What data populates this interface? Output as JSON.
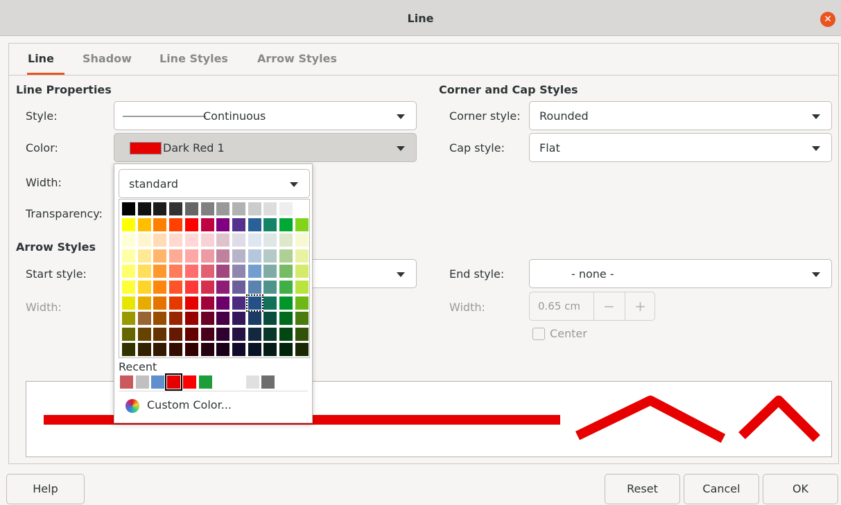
{
  "window": {
    "title": "Line"
  },
  "tabs": [
    {
      "label": "Line",
      "active": true
    },
    {
      "label": "Shadow"
    },
    {
      "label": "Line Styles"
    },
    {
      "label": "Arrow Styles"
    }
  ],
  "line_properties": {
    "title": "Line Properties",
    "style_label": "Style:",
    "style_value": "Continuous",
    "color_label": "Color:",
    "color_value": "Dark Red 1",
    "color_hex": "#e60000",
    "width_label": "Width:",
    "transparency_label": "Transparency:"
  },
  "corner_cap": {
    "title": "Corner and Cap Styles",
    "corner_label": "Corner style:",
    "corner_value": "Rounded",
    "cap_label": "Cap style:",
    "cap_value": "Flat"
  },
  "arrow_styles": {
    "title": "Arrow Styles",
    "start_label": "Start style:",
    "start_width_label": "Width:",
    "end_label": "End style:",
    "end_value": "- none -",
    "end_width_label": "Width:",
    "end_width_value": "0.65 cm",
    "center_label": "Center"
  },
  "color_popup": {
    "palette": "standard",
    "recent_label": "Recent",
    "custom_color_label": "Custom Color...",
    "grid": [
      [
        "#000000",
        "#111111",
        "#1c1c1c",
        "#333333",
        "#666666",
        "#808080",
        "#999999",
        "#b2b2b2",
        "#cccccc",
        "#dddddd",
        "#eeeeee",
        "#ffffff"
      ],
      [
        "#ffff00",
        "#ffbf00",
        "#ff8000",
        "#ff4000",
        "#ff0000",
        "#bf0041",
        "#800080",
        "#55308d",
        "#2a6099",
        "#158466",
        "#00a933",
        "#81d41a"
      ],
      [
        "#ffffd7",
        "#fff5ce",
        "#ffdbb6",
        "#ffd8ce",
        "#ffd7d7",
        "#f7d1d5",
        "#e0c2cd",
        "#dedce6",
        "#dee6ef",
        "#dee7e5",
        "#dde8cb",
        "#f6f9d4"
      ],
      [
        "#ffffa6",
        "#ffe994",
        "#ffb66c",
        "#ffaa95",
        "#ffa6a6",
        "#ec9ba4",
        "#bf819e",
        "#b7b3ca",
        "#b4c7dc",
        "#b3cac7",
        "#afd095",
        "#e8f2a1"
      ],
      [
        "#ffff6d",
        "#ffde59",
        "#ff972f",
        "#ff7b59",
        "#ff6d6d",
        "#e16173",
        "#a1467e",
        "#8e86ae",
        "#729fcf",
        "#81aca6",
        "#77bc65",
        "#d4ea6b"
      ],
      [
        "#ffff38",
        "#ffd428",
        "#ff860d",
        "#ff5429",
        "#ff3838",
        "#d62e4e",
        "#8d1d75",
        "#6b5e9b",
        "#5983b0",
        "#50938a",
        "#3faf46",
        "#bbe33d"
      ],
      [
        "#e6e600",
        "#e6ac00",
        "#e67300",
        "#e63900",
        "#e60000",
        "#a1003a",
        "#6b006b",
        "#4c2a7f",
        "#235187",
        "#127159",
        "#009628",
        "#6fb716"
      ],
      [
        "#999900",
        "#996633",
        "#994d00",
        "#992600",
        "#990000",
        "#6b0026",
        "#470047",
        "#33195c",
        "#1a3c65",
        "#0b4d3d",
        "#006b1c",
        "#4a7b0e"
      ],
      [
        "#666600",
        "#664400",
        "#663300",
        "#661900",
        "#660000",
        "#48001a",
        "#300030",
        "#261142",
        "#112840",
        "#083729",
        "#004711",
        "#325209"
      ],
      [
        "#333300",
        "#332200",
        "#331900",
        "#330d00",
        "#330000",
        "#240010",
        "#180018",
        "#13092c",
        "#081425",
        "#041c15",
        "#002409",
        "#192904"
      ]
    ],
    "selected": [
      6,
      8
    ],
    "recent": [
      "#c9595d",
      "#c0c0c0",
      "#5f8fcc",
      "#e60000",
      "#ff0000",
      "#1e9e3b",
      "#ffffff",
      "#ffffff",
      "#e0e0e0",
      "#6e6e6e"
    ],
    "recent_selected": 3
  },
  "buttons": {
    "help": "Help",
    "reset": "Reset",
    "cancel": "Cancel",
    "ok": "OK"
  }
}
